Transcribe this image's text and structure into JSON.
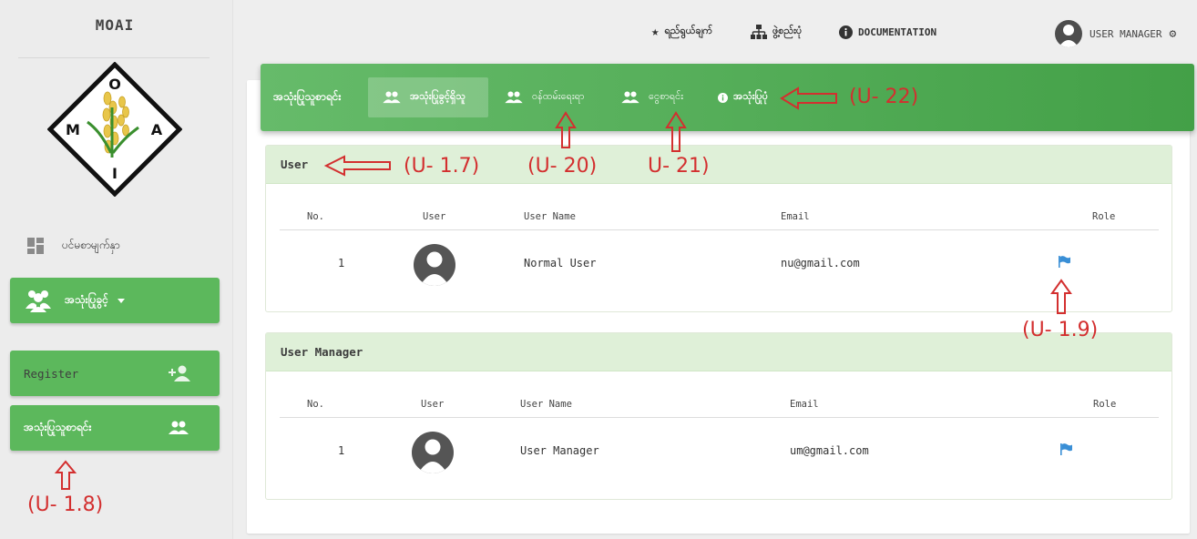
{
  "sidebar": {
    "brand": "MOAI",
    "logo_letters": {
      "top": "O",
      "left": "M",
      "right": "A",
      "bottom": "I"
    },
    "dashboard_label": "ပင်မစာမျက်နှာ",
    "users_label": "အသုံးပြုခွင့်",
    "register_label": "Register",
    "userlist_label": "အသုံးပြုသူစာရင်း"
  },
  "topnav": {
    "favorites_label": "ရည်ရွယ်ချက်",
    "structure_label": "ဖွဲ့စည်းပုံ",
    "documentation_label": "DOCUMENTATION",
    "user_label": "USER MANAGER"
  },
  "tabbar": {
    "title": "အသုံးပြုသူစာရင်း",
    "tabs": [
      {
        "label": "အသုံးပြုခွင့်ရှိသူ"
      },
      {
        "label": "ဝန်ထမ်းရေးရာ"
      },
      {
        "label": "ငွေစာရင်း"
      },
      {
        "label": "အသုံးပြုပုံ"
      }
    ]
  },
  "columns": [
    "No.",
    "User",
    "User Name",
    "Email",
    "Role"
  ],
  "panels": [
    {
      "title": "User",
      "rows": [
        {
          "no": "1",
          "user_name": "Normal User",
          "email": "nu@gmail.com"
        }
      ]
    },
    {
      "title": "User Manager",
      "rows": [
        {
          "no": "1",
          "user_name": "User Manager",
          "email": "um@gmail.com"
        }
      ]
    }
  ],
  "annotations": {
    "u22": "(U- 22)",
    "u17": "(U- 1.7)",
    "u20": "(U- 20)",
    "u21": "U- 21)",
    "u19": "(U- 1.9)",
    "u18": "(U- 1.8)"
  },
  "colors": {
    "accent_green": "#5cb85c",
    "panel_head": "#dff0d8",
    "annotation_red": "#d32f2f",
    "flag_blue": "#3a8fd6"
  }
}
